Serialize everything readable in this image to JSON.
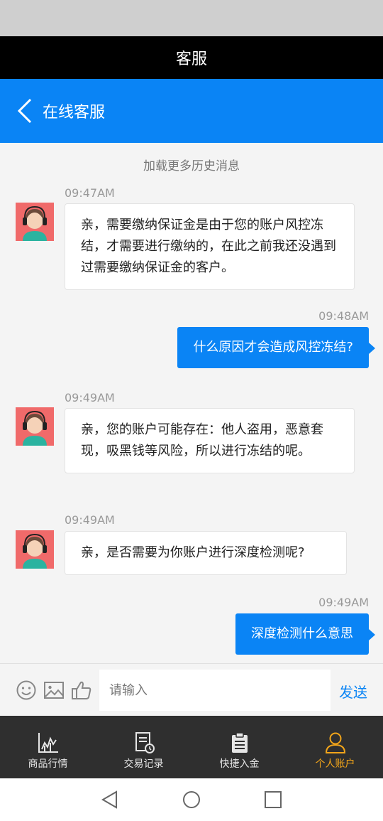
{
  "window": {
    "title": "客服"
  },
  "header": {
    "title": "在线客服"
  },
  "chat": {
    "load_more": "加载更多历史消息",
    "messages": [
      {
        "side": "left",
        "time": "09:47AM",
        "text": "亲，需要缴纳保证金是由于您的账户风控冻结，才需要进行缴纳的，在此之前我还没遇到过需要缴纳保证金的客户。"
      },
      {
        "side": "right",
        "time": "09:48AM",
        "text": "什么原因才会造成风控冻结?"
      },
      {
        "side": "left",
        "time": "09:49AM",
        "text": "亲，您的账户可能存在：他人盗用，恶意套现，吸黑钱等风险，所以进行冻结的呢。"
      },
      {
        "side": "left",
        "time": "09:49AM",
        "text": "亲，是否需要为你账户进行深度检测呢?"
      },
      {
        "side": "right",
        "time": "09:49AM",
        "text": "深度检测什么意思"
      }
    ]
  },
  "input": {
    "placeholder": "请输入",
    "send_label": "发送"
  },
  "tabs": [
    {
      "label": "商品行情",
      "icon": "chart-icon"
    },
    {
      "label": "交易记录",
      "icon": "record-icon"
    },
    {
      "label": "快捷入金",
      "icon": "clipboard-icon"
    },
    {
      "label": "个人账户",
      "icon": "user-icon",
      "active": true
    }
  ],
  "colors": {
    "primary": "#0a84f5",
    "active_tab": "#f2a51a",
    "tab_bar": "#2f2f2f"
  }
}
